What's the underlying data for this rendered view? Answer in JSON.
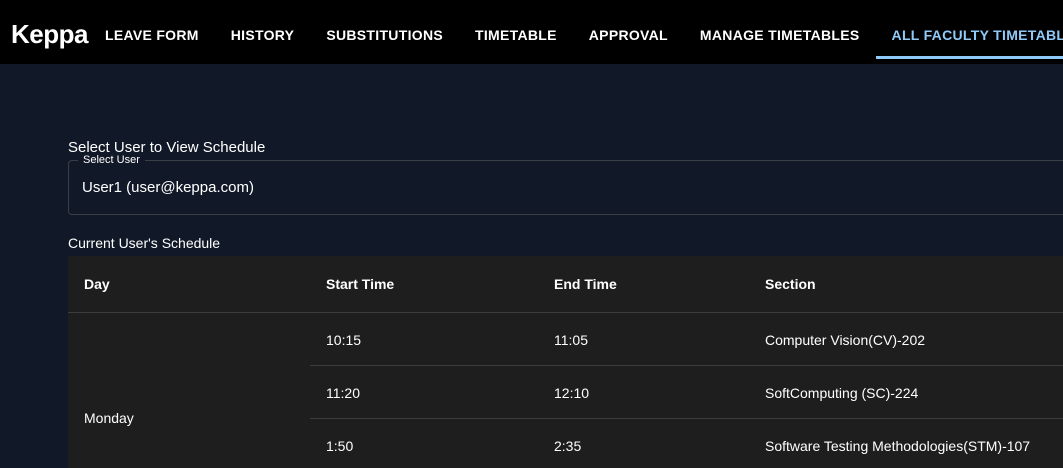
{
  "brand": "Keppa",
  "nav": {
    "tabs": [
      {
        "label": "LEAVE FORM"
      },
      {
        "label": "HISTORY"
      },
      {
        "label": "SUBSTITUTIONS"
      },
      {
        "label": "TIMETABLE"
      },
      {
        "label": "APPROVAL"
      },
      {
        "label": "MANAGE TIMETABLES"
      },
      {
        "label": "ALL FACULTY TIMETABLES",
        "active": true
      }
    ]
  },
  "page": {
    "heading": "Select User to View Schedule",
    "select": {
      "label": "Select User",
      "value": "User1 (user@keppa.com)"
    },
    "schedule_heading": "Current User's Schedule"
  },
  "table": {
    "columns": [
      "Day",
      "Start Time",
      "End Time",
      "Section"
    ],
    "day": "Monday",
    "rows": [
      {
        "start": "10:15",
        "end": "11:05",
        "section": "Computer Vision(CV)-202"
      },
      {
        "start": "11:20",
        "end": "12:10",
        "section": "SoftComputing (SC)-224"
      },
      {
        "start": "1:50",
        "end": "2:35",
        "section": "Software Testing Methodologies(STM)-107"
      }
    ]
  },
  "colors": {
    "background": "#111827",
    "navbar": "#000000",
    "accent": "#90caf9",
    "table_background": "#1e1e1e"
  }
}
